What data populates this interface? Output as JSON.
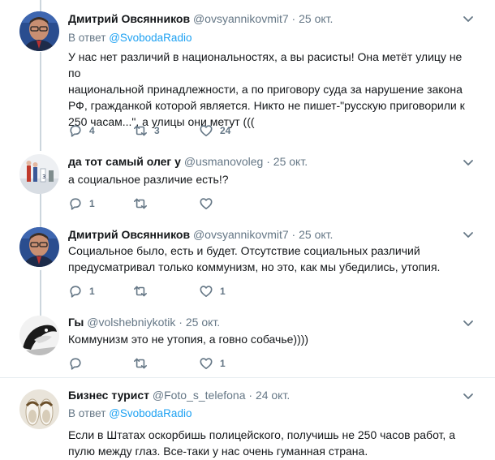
{
  "tweets": [
    {
      "name": "Дмитрий Овсянников",
      "handle": "@ovsyannikovmit7",
      "dot": "·",
      "date": "25 окт.",
      "reply_prefix": "В ответ",
      "reply_to": "@SvobodaRadio",
      "lines": [
        "У нас нет различий в национальностях, а вы расисты! Она метёт улицу не по",
        "национальной принадлежности, а по приговору суда за нарушение закона",
        "РФ, гражданкой которой является. Никто не пишет-\"русскую приговорили к",
        "250 часам...\", а улицы они метут ((("
      ],
      "replies": "4",
      "retweets": "3",
      "likes": "24"
    },
    {
      "name": "да тот самый олег у",
      "handle": "@usmanovoleg",
      "dot": "·",
      "date": "25 окт.",
      "lines": [
        "а социальное различие есть!?"
      ],
      "replies": "1",
      "retweets": "",
      "likes": ""
    },
    {
      "name": "Дмитрий Овсянников",
      "handle": "@ovsyannikovmit7",
      "dot": "·",
      "date": "25 окт.",
      "lines": [
        "Социальное было, есть и будет. Отсутствие социальных различий",
        "предусматривал только коммунизм, но это, как мы убедились, утопия."
      ],
      "replies": "1",
      "retweets": "",
      "likes": "1"
    },
    {
      "name": "Гы",
      "handle": "@volshebniykotik",
      "dot": "·",
      "date": "25 окт.",
      "lines": [
        "Коммунизм это не утопия, а говно собачье))))"
      ],
      "replies": "",
      "retweets": "",
      "likes": "1"
    },
    {
      "name": "Бизнес турист",
      "handle": "@Foto_s_telefona",
      "dot": "·",
      "date": "24 окт.",
      "reply_prefix": "В ответ",
      "reply_to": "@SvobodaRadio",
      "lines": [
        "Если в Штатах оскорбишь полицейского, получишь не 250 часов работ, а",
        "пулю между глаз. Все-таки у нас очень гуманная страна."
      ],
      "replies": "",
      "retweets": "",
      "likes": ""
    }
  ],
  "colors": {
    "text": "#14171a",
    "secondary": "#657786",
    "link": "#1da1f2",
    "thread_line": "#ccd6dd",
    "divider": "#e6ecf0"
  },
  "icons": {
    "reply": "reply-icon",
    "retweet": "retweet-icon",
    "like": "heart-icon",
    "menu": "chevron-down-icon"
  }
}
